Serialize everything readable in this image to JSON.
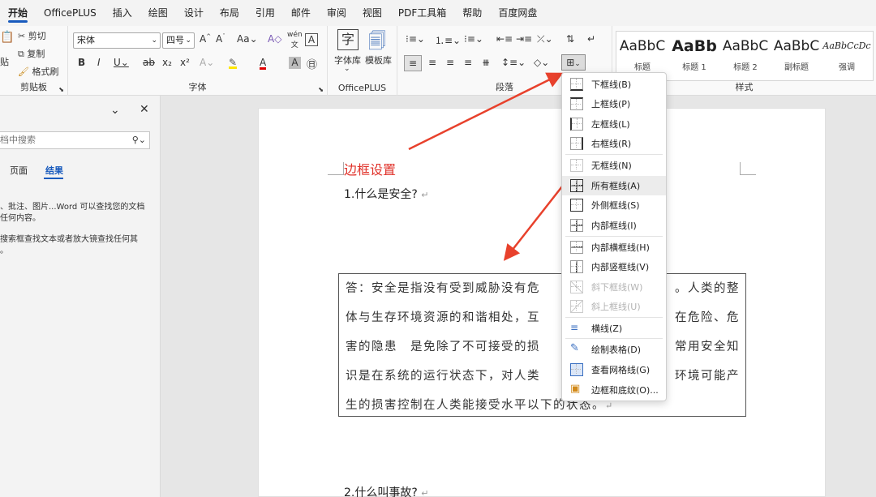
{
  "menubar": {
    "tabs": [
      "开始",
      "OfficePLUS",
      "插入",
      "绘图",
      "设计",
      "布局",
      "引用",
      "邮件",
      "审阅",
      "视图",
      "PDF工具箱",
      "帮助",
      "百度网盘"
    ]
  },
  "ribbon": {
    "clipboard": {
      "cut": "剪切",
      "copy": "复制",
      "format_painter": "格式刷",
      "paste_partial": "贴",
      "label": "剪贴板"
    },
    "font": {
      "font_name": "宋体",
      "font_size": "四号",
      "label": "字体"
    },
    "officeplus": {
      "font_lib": "字体库",
      "template_lib": "模板库",
      "label": "OfficePLUS"
    },
    "paragraph": {
      "label": "段落"
    },
    "styles": {
      "label": "样式",
      "items": [
        {
          "preview": "AaBbC",
          "name": "标题"
        },
        {
          "preview": "AaBb",
          "name": "标题 1"
        },
        {
          "preview": "AaBbC",
          "name": "标题 2"
        },
        {
          "preview": "AaBbC",
          "name": "副标题"
        },
        {
          "preview": "AaBbCcDc",
          "name": "强调"
        }
      ]
    }
  },
  "nav": {
    "search_placeholder": "档中搜索",
    "tab_pages": "页面",
    "tab_results": "结果",
    "hint1_line1": "、批注、图片...Word 可以查找您的文档",
    "hint1_line2": "任何内容。",
    "hint2_line1": "搜索框查找文本或者放大镜查找任何其",
    "hint2_line2": "。"
  },
  "doc": {
    "title": "边框设置",
    "q1": "1.什么是安全?",
    "q2": "2.什么叫事故?",
    "para_lines": [
      "答：安全是指没有受到威胁没有危",
      "体与生存环境资源的和谐相处，互",
      "害的隐患　是免除了不可接受的损",
      "识是在系统的运行状态下，对人类",
      "生的损害控制在人类能接受水平以下的状态。"
    ],
    "para_right_lines": [
      "。人类的整",
      "在危险、危",
      "常用安全知",
      "环境可能产"
    ]
  },
  "border_menu": {
    "items": [
      "下框线(B)",
      "上框线(P)",
      "左框线(L)",
      "右框线(R)",
      "无框线(N)",
      "所有框线(A)",
      "外侧框线(S)",
      "内部框线(I)",
      "内部横框线(H)",
      "内部竖框线(V)",
      "斜下框线(W)",
      "斜上框线(U)",
      "横线(Z)",
      "绘制表格(D)",
      "查看网格线(G)",
      "边框和底纹(O)..."
    ]
  },
  "colors": {
    "accent": "#185abd",
    "title_red": "#e0322a",
    "arrow_red": "#e8412c"
  }
}
